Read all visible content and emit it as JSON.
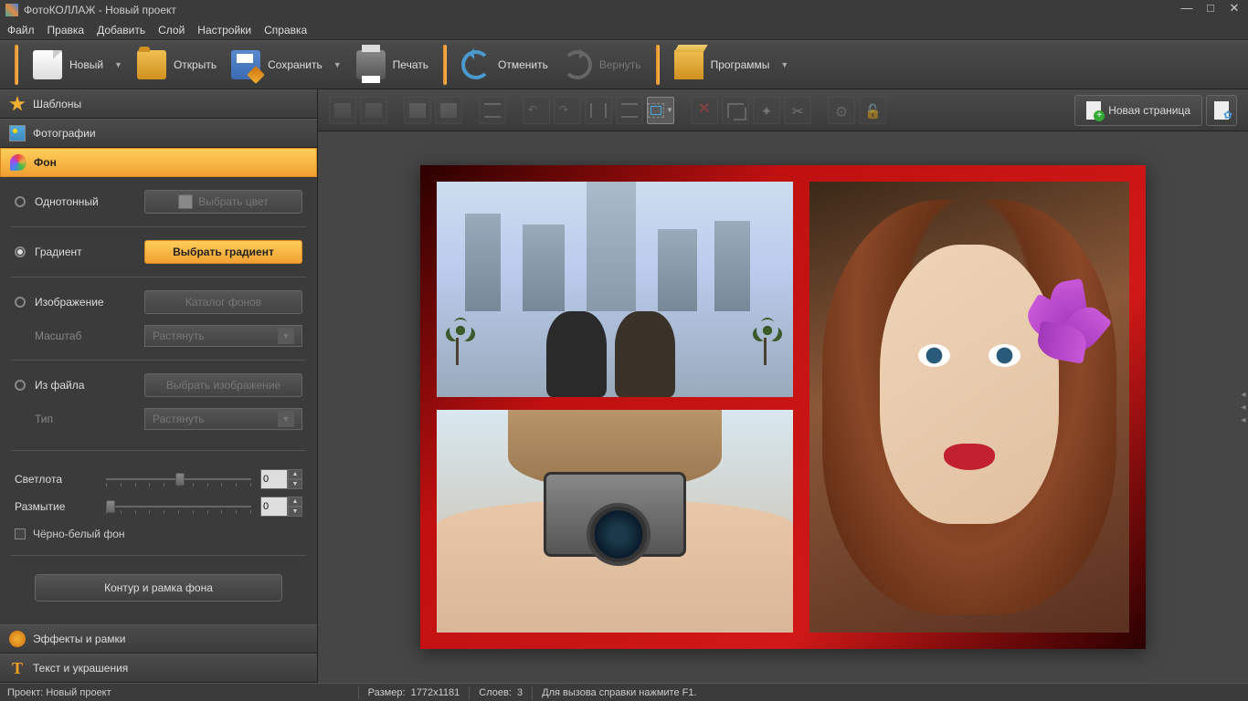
{
  "title": "ФотоКОЛЛАЖ - Новый проект",
  "menu": [
    "Файл",
    "Правка",
    "Добавить",
    "Слой",
    "Настройки",
    "Справка"
  ],
  "toolbar": {
    "new": "Новый",
    "open": "Открыть",
    "save": "Сохранить",
    "print": "Печать",
    "undo": "Отменить",
    "redo": "Вернуть",
    "programs": "Программы"
  },
  "sidebar": {
    "templates": "Шаблоны",
    "photos": "Фотографии",
    "background": "Фон",
    "effects": "Эффекты и рамки",
    "text": "Текст и украшения"
  },
  "bg_panel": {
    "solid": "Однотонный",
    "solid_btn": "Выбрать цвет",
    "gradient": "Градиент",
    "gradient_btn": "Выбрать градиент",
    "image": "Изображение",
    "image_btn": "Каталог фонов",
    "scale_label": "Масштаб",
    "scale_value": "Растянуть",
    "fromfile": "Из файла",
    "fromfile_btn": "Выбрать изображение",
    "type_label": "Тип",
    "type_value": "Растянуть",
    "brightness": "Светлота",
    "brightness_value": "0",
    "blur": "Размытие",
    "blur_value": "0",
    "bw": "Чёрно-белый фон",
    "outline_btn": "Контур и рамка фона"
  },
  "canvas_toolbar": {
    "new_page": "Новая страница"
  },
  "status": {
    "project_label": "Проект:",
    "project_name": "Новый проект",
    "size_label": "Размер:",
    "size_value": "1772x1181",
    "layers_label": "Слоев:",
    "layers_value": "3",
    "help": "Для вызова справки нажмите F1."
  }
}
